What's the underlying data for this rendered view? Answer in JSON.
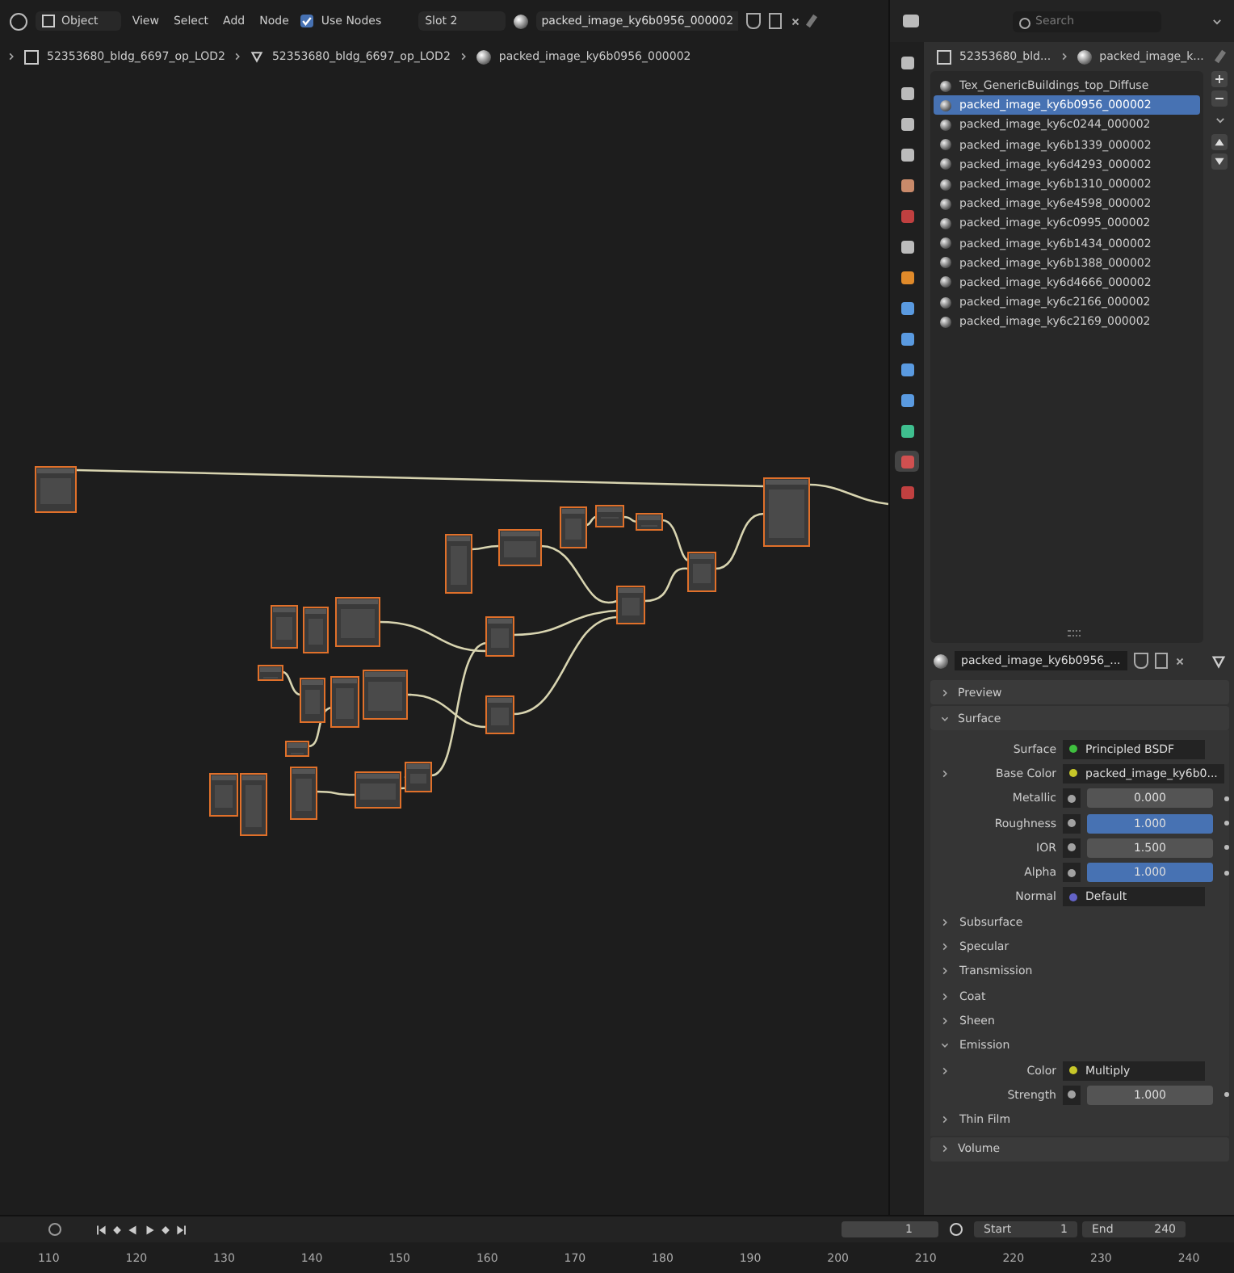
{
  "header": {
    "mode": "Object",
    "menus": [
      "View",
      "Select",
      "Add",
      "Node"
    ],
    "use_nodes": {
      "label": "Use Nodes",
      "checked": true
    },
    "slot": "Slot 2",
    "material": "packed_image_ky6b0956_000002"
  },
  "breadcrumb": [
    {
      "kind": "object",
      "label": "52353680_bldg_6697_op_LOD2"
    },
    {
      "kind": "mesh",
      "label": "52353680_bldg_6697_op_LOD2"
    },
    {
      "kind": "material",
      "label": "packed_image_ky6b0956_000002"
    }
  ],
  "properties": {
    "search": {
      "placeholder": "Search"
    },
    "breadcrumb": [
      {
        "kind": "object",
        "label": "52353680_bld..."
      },
      {
        "kind": "material",
        "label": "packed_image_k..."
      }
    ],
    "tabs": [
      {
        "kind": "tool",
        "selected": false
      },
      {
        "kind": "render",
        "selected": false
      },
      {
        "kind": "output",
        "selected": false
      },
      {
        "kind": "view_layer",
        "selected": false
      },
      {
        "kind": "scene",
        "selected": false
      },
      {
        "kind": "world",
        "selected": false
      },
      {
        "kind": "collection",
        "selected": false
      },
      {
        "kind": "object",
        "selected": false
      },
      {
        "kind": "modifier",
        "selected": false
      },
      {
        "kind": "particles",
        "selected": false
      },
      {
        "kind": "physics",
        "selected": false
      },
      {
        "kind": "constraints",
        "selected": false
      },
      {
        "kind": "data",
        "selected": false
      },
      {
        "kind": "material",
        "selected": true
      },
      {
        "kind": "texture",
        "selected": false
      }
    ],
    "slots": [
      {
        "label": "Tex_GenericBuildings_top_Diffuse",
        "selected": false
      },
      {
        "label": "packed_image_ky6b0956_000002",
        "selected": true
      },
      {
        "label": "packed_image_ky6c0244_000002",
        "selected": false
      },
      {
        "label": "packed_image_ky6b1339_000002",
        "selected": false
      },
      {
        "label": "packed_image_ky6d4293_000002",
        "selected": false
      },
      {
        "label": "packed_image_ky6b1310_000002",
        "selected": false
      },
      {
        "label": "packed_image_ky6e4598_000002",
        "selected": false
      },
      {
        "label": "packed_image_ky6c0995_000002",
        "selected": false
      },
      {
        "label": "packed_image_ky6b1434_000002",
        "selected": false
      },
      {
        "label": "packed_image_ky6b1388_000002",
        "selected": false
      },
      {
        "label": "packed_image_ky6d4666_000002",
        "selected": false
      },
      {
        "label": "packed_image_ky6c2166_000002",
        "selected": false
      },
      {
        "label": "packed_image_ky6c2169_000002",
        "selected": false
      }
    ],
    "material_name": "packed_image_ky6b0956_...",
    "panels": [
      {
        "label": "Preview",
        "expanded": false
      },
      {
        "label": "Surface",
        "expanded": true
      }
    ],
    "surface_rows": [
      {
        "kind": "link",
        "label": "Surface",
        "value": "Principled BSDF",
        "color": "#3fbf3f",
        "expandable": false
      },
      {
        "kind": "link",
        "label": "Base Color",
        "value": "packed_image_ky6b0...",
        "color": "#c7c729",
        "expandable": true
      },
      {
        "kind": "number",
        "label": "Metallic",
        "value": "0.000",
        "color": "#a1a1a1",
        "level": 0
      },
      {
        "kind": "number",
        "label": "Roughness",
        "value": "1.000",
        "color": "#a1a1a1",
        "level": 1
      },
      {
        "kind": "number",
        "label": "IOR",
        "value": "1.500",
        "color": "#a1a1a1"
      },
      {
        "kind": "number",
        "label": "Alpha",
        "value": "1.000",
        "color": "#a1a1a1",
        "level": 1
      },
      {
        "kind": "link",
        "label": "Normal",
        "value": "Default",
        "color": "#6363c7",
        "expandable": false
      },
      {
        "kind": "section",
        "label": "Subsurface",
        "expanded": false
      },
      {
        "kind": "section",
        "label": "Specular",
        "expanded": false
      },
      {
        "kind": "section",
        "label": "Transmission",
        "expanded": false
      },
      {
        "kind": "section",
        "label": "Coat",
        "expanded": false
      },
      {
        "kind": "section",
        "label": "Sheen",
        "expanded": false
      },
      {
        "kind": "section",
        "label": "Emission",
        "expanded": true
      },
      {
        "kind": "link",
        "label": "Color",
        "value": "Multiply",
        "color": "#c7c729",
        "expandable": true
      },
      {
        "kind": "number",
        "label": "Strength",
        "value": "1.000",
        "color": "#a1a1a1"
      },
      {
        "kind": "section",
        "label": "Thin Film",
        "expanded": false
      }
    ],
    "volume": {
      "label": "Volume",
      "expanded": false
    }
  },
  "timeline": {
    "current_frame": "1",
    "start_label": "Start",
    "start": "1",
    "end_label": "End",
    "end": "240",
    "ruler": [
      "110",
      "120",
      "130",
      "140",
      "150",
      "160",
      "170",
      "180",
      "190",
      "200",
      "210",
      "220",
      "230",
      "240"
    ]
  }
}
